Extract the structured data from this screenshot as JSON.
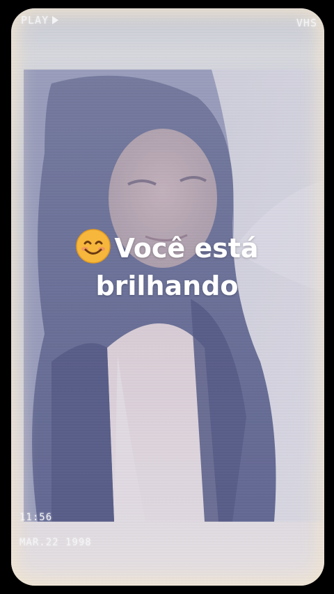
{
  "overlay": {
    "play_label": "PLAY",
    "format_label": "VHS",
    "time": "11:56",
    "date": "MAR.22 1998"
  },
  "caption": {
    "line1": "Você está",
    "line2": "brilhando",
    "emoji_icon": "smiling-face-icon"
  },
  "colors": {
    "caption_text": "#ffffff",
    "frame_glow": "#f0e4cd",
    "emoji_face": "#f6b73c"
  }
}
